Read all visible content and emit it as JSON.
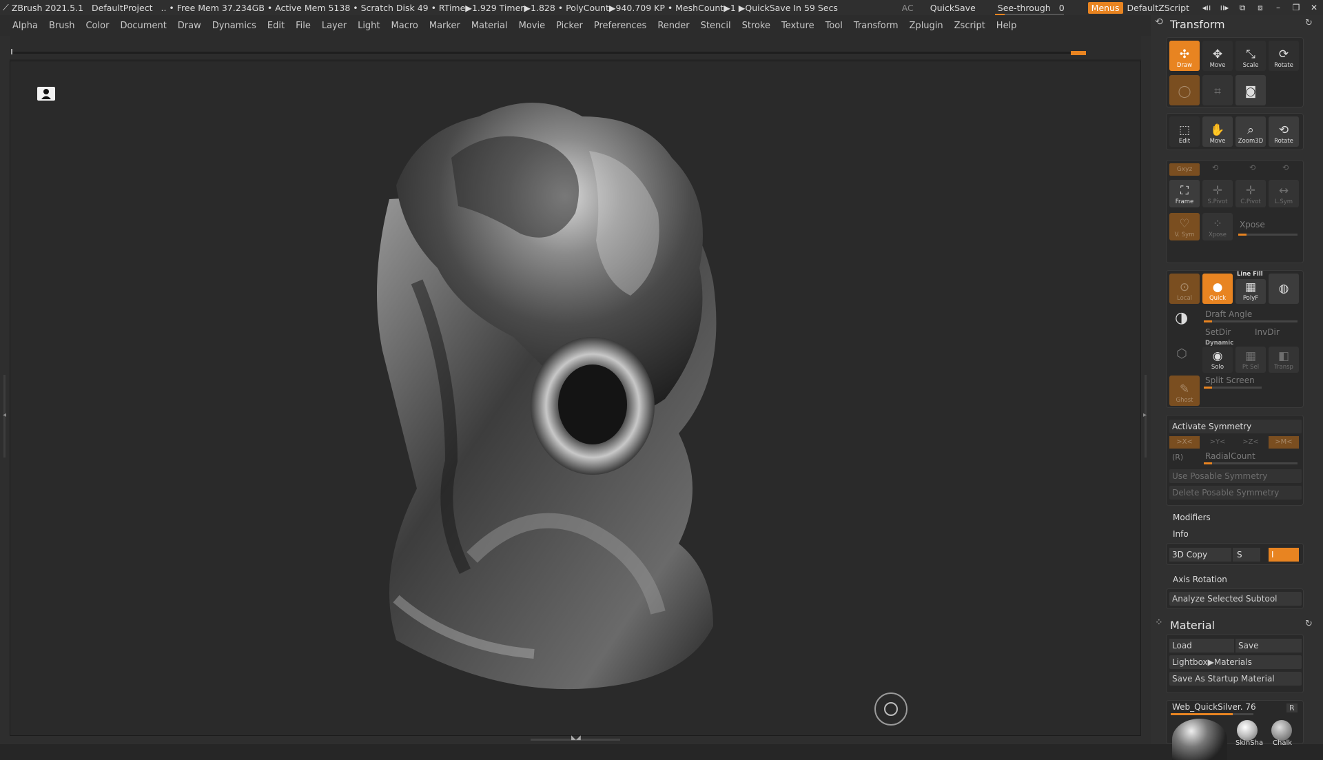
{
  "titlebar": {
    "app": "ZBrush 2021.5.1",
    "project": "DefaultProject",
    "stats": "..  • Free Mem 37.234GB • Active Mem 5138 • Scratch Disk 49 •  RTime▶1.929 Timer▶1.828 • PolyCount▶940.709 KP  • MeshCount▶1   ▶QuickSave In 59 Secs",
    "ac": "AC",
    "quicksave": "QuickSave",
    "seethrough_label": "See-through",
    "seethrough_value": "0",
    "menus": "Menus",
    "script": "DefaultZScript"
  },
  "menubar": [
    "Alpha",
    "Brush",
    "Color",
    "Document",
    "Draw",
    "Dynamics",
    "Edit",
    "File",
    "Layer",
    "Light",
    "Macro",
    "Marker",
    "Material",
    "Movie",
    "Picker",
    "Preferences",
    "Render",
    "Stencil",
    "Stroke",
    "Texture",
    "Tool",
    "Transform",
    "Zplugin",
    "Zscript",
    "Help"
  ],
  "transform": {
    "title": "Transform",
    "top_buttons": [
      "Draw",
      "Move",
      "Scale",
      "Rotate"
    ],
    "nav_buttons": [
      "Edit",
      "Move",
      "Zoom3D",
      "Rotate"
    ],
    "xyz": "Gxyz",
    "frame_row": [
      "Frame",
      "S.Pivot",
      "C.Pivot",
      "L.Sym"
    ],
    "vsym": "V. Sym",
    "xpose_btn": "Xpose",
    "xpose": "Xpose",
    "local": "Local",
    "quick": "Quick",
    "linefill": "Line Fill",
    "polyf": "PolyF",
    "draft_angle": "Draft Angle",
    "setdir": "SetDir",
    "invdir": "InvDir",
    "dynamic": "Dynamic",
    "solo": "Solo",
    "ptsel": "Pt Sel",
    "transp": "Transp",
    "ghost": "Ghost",
    "split_screen": "Split Screen",
    "activate_symmetry": "Activate Symmetry",
    "sym_axes": [
      ">X<",
      ">Y<",
      ">Z<",
      ">M<"
    ],
    "r": "(R)",
    "radialcount": "RadialCount",
    "use_posable": "Use Posable Symmetry",
    "delete_posable": "Delete Posable Symmetry",
    "modifiers": "Modifiers",
    "info": "Info",
    "copy3d": "3D Copy",
    "s": "S",
    "i": "I",
    "axis_rotation": "Axis Rotation",
    "analyze": "Analyze Selected Subtool"
  },
  "material": {
    "title": "Material",
    "load": "Load",
    "save": "Save",
    "lightbox": "Lightbox▶Materials",
    "save_startup": "Save As Startup Material",
    "current": "Web_QuickSilver. 76",
    "r": "R",
    "thumbs": [
      "SkinSha",
      "Chalk"
    ]
  },
  "colors": {
    "accent": "#e88421",
    "panel": "#303030",
    "viewport": "#2a2a2a"
  }
}
